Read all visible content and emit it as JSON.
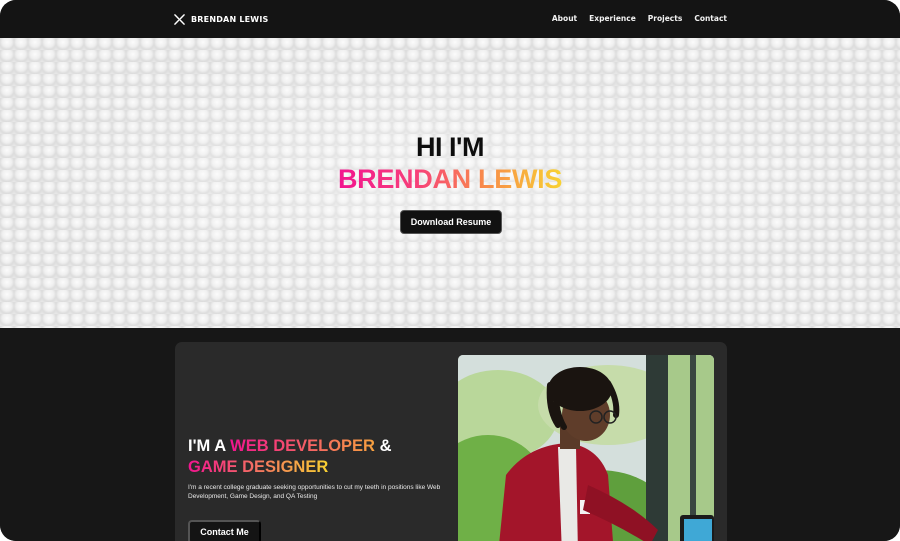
{
  "nav": {
    "brand": "BRENDAN LEWIS",
    "brand_icon": "x-logo-icon",
    "links": [
      "About",
      "Experience",
      "Projects",
      "Contact"
    ]
  },
  "hero": {
    "greeting": "HI I'M",
    "name": "BRENDAN LEWIS",
    "resume_button": "Download Resume"
  },
  "about": {
    "heading_prefix": "I'M A ",
    "role1": "WEB DEVELOPER",
    "joiner": " &",
    "role2": "GAME DESIGNER",
    "description": "I'm a recent college graduate seeking opportunities to cut my teeth in positions like Web Development, Game Design, and QA Testing",
    "contact_button": "Contact Me",
    "photo_icon": "profile-photo"
  },
  "colors": {
    "accent_pink": "#f2148f",
    "accent_yellow": "#f8d232",
    "dark": "#171717"
  }
}
